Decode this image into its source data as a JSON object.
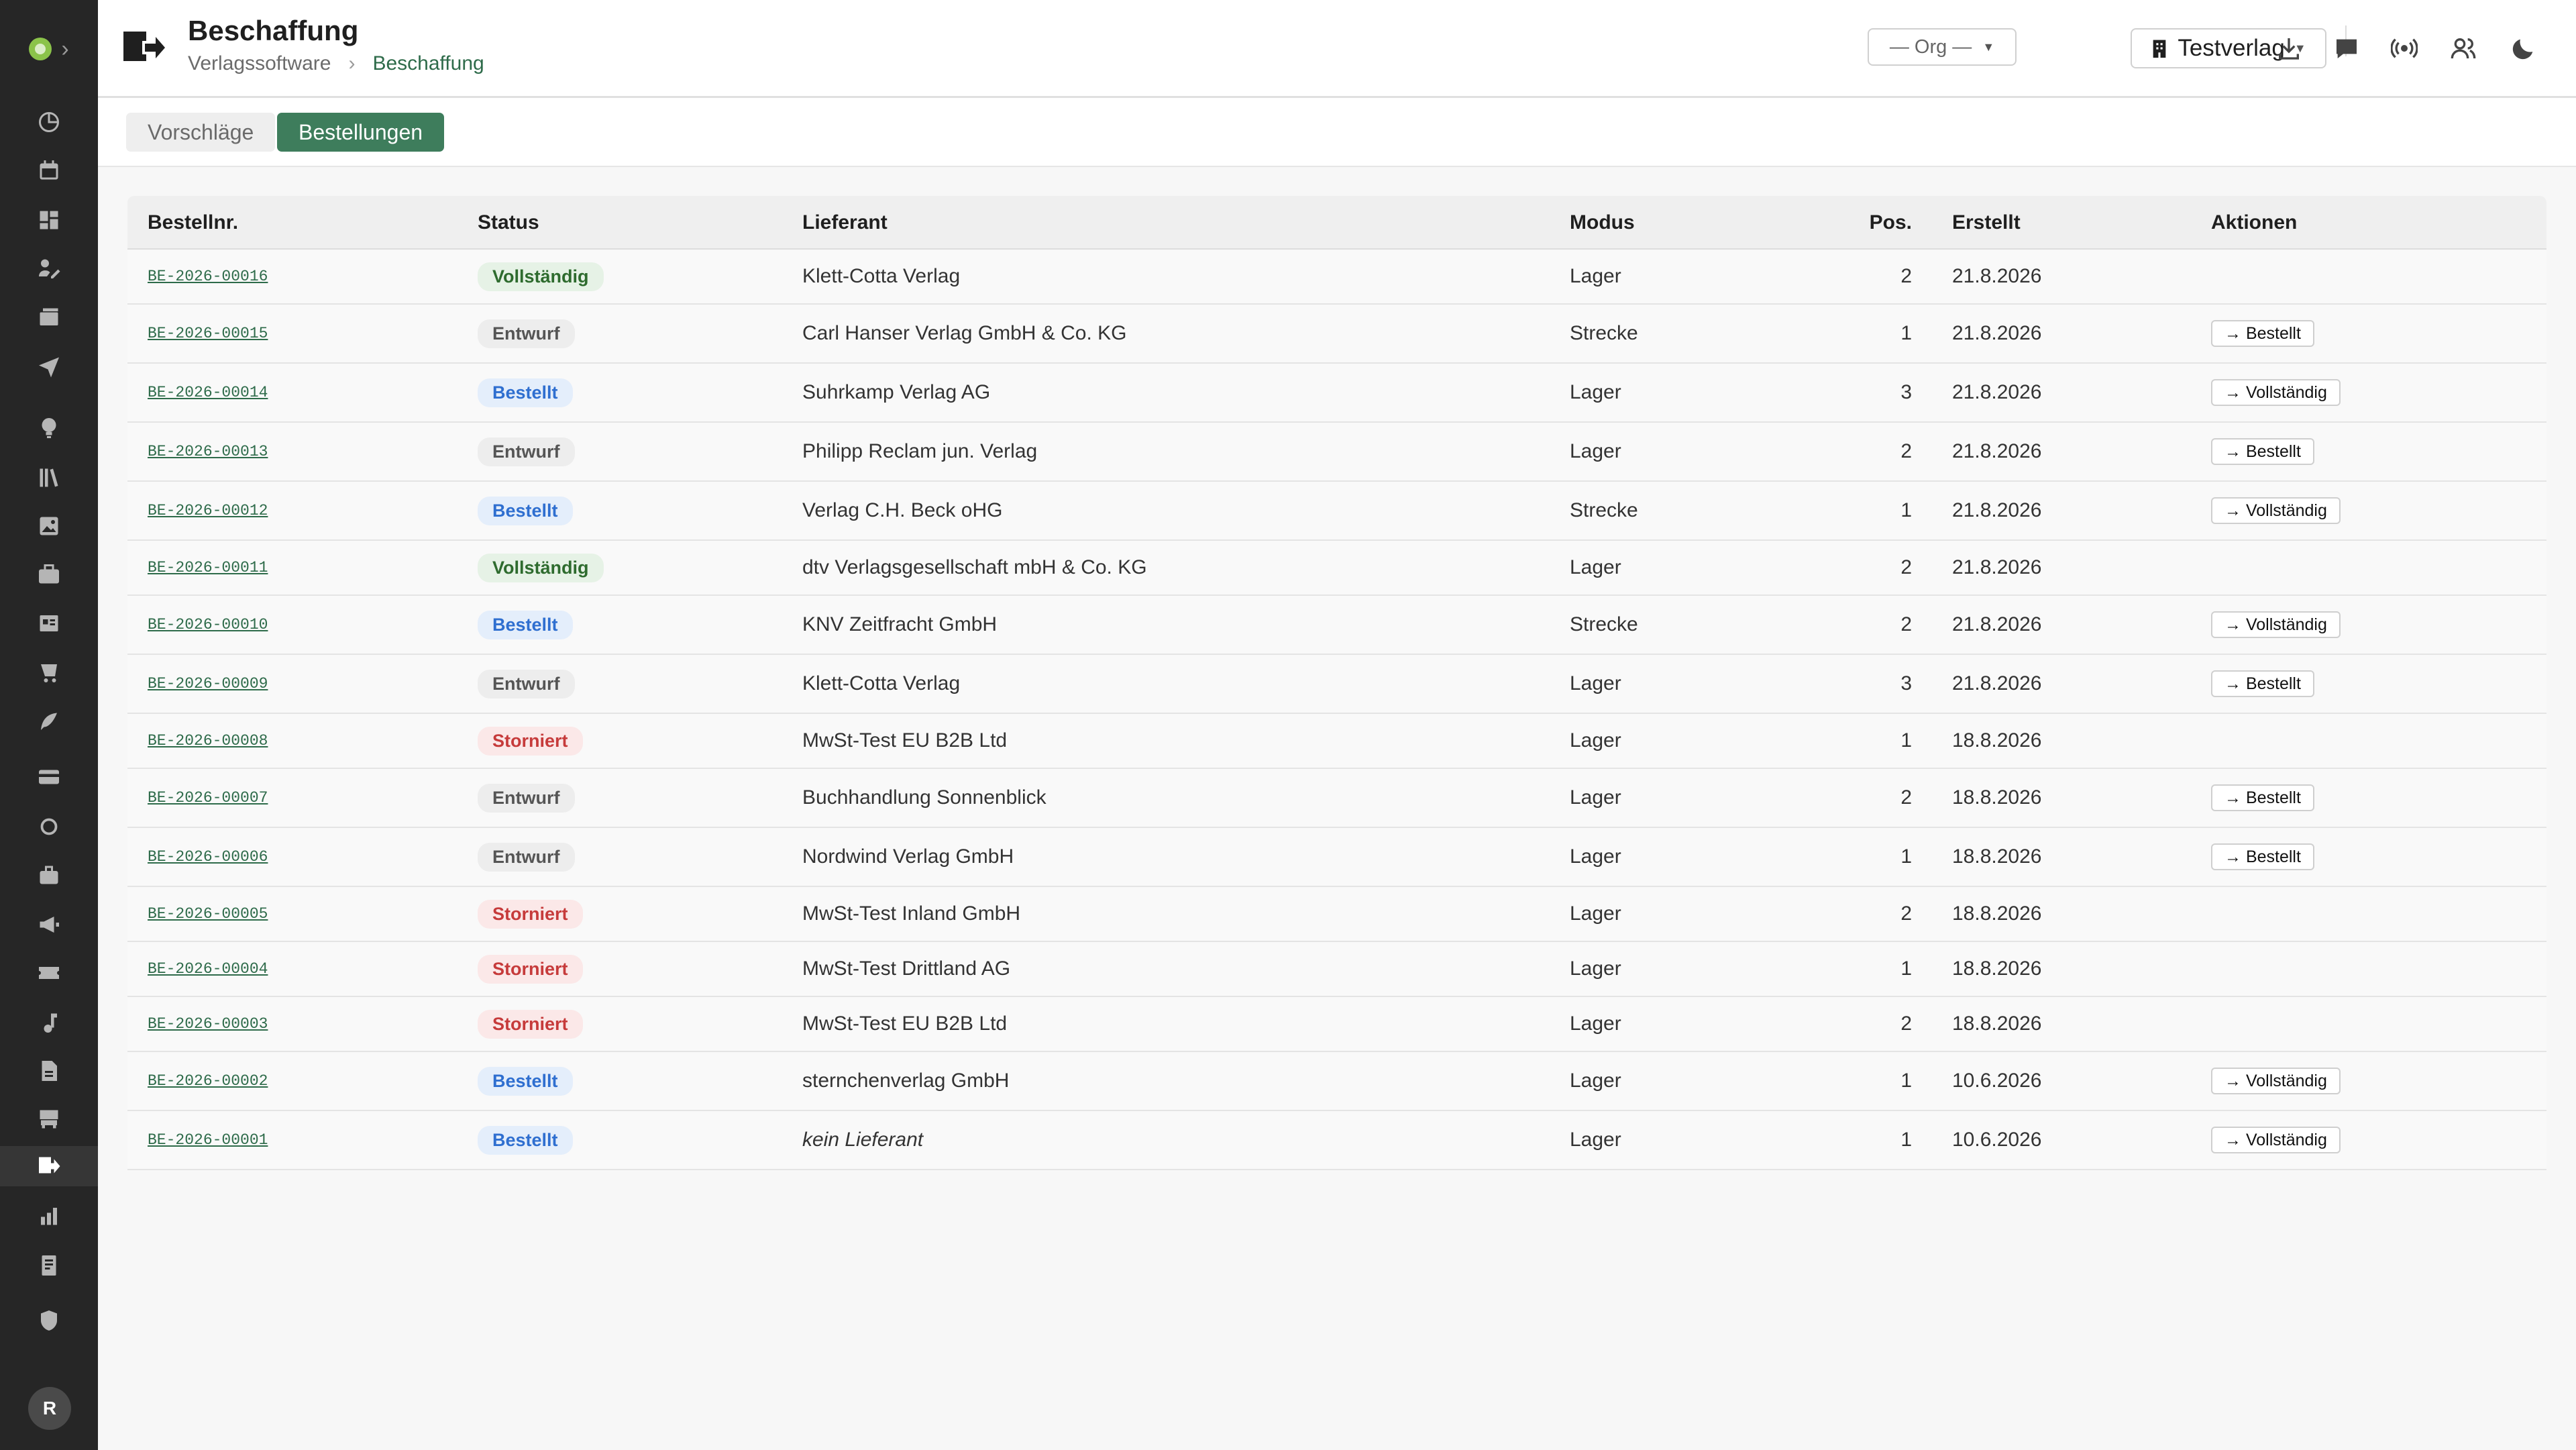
{
  "header": {
    "title": "Beschaffung",
    "breadcrumb": {
      "root": "Verlagssoftware",
      "separator": "›",
      "current": "Beschaffung"
    },
    "org_select": {
      "value": "— Org —"
    },
    "tenant_select": {
      "value": "Testverlag"
    }
  },
  "user": {
    "avatar_initial": "R"
  },
  "tabs": [
    {
      "label": "Vorschläge",
      "active": false
    },
    {
      "label": "Bestellungen",
      "active": true
    }
  ],
  "table": {
    "columns": {
      "id": "Bestellnr.",
      "status": "Status",
      "supplier": "Lieferant",
      "mode": "Modus",
      "pos": "Pos.",
      "created": "Erstellt",
      "actions": "Aktionen"
    },
    "rows": [
      {
        "id": "BE-2026-00016",
        "status": "Vollständig",
        "supplier": "Klett-Cotta Verlag",
        "mode": "Lager",
        "pos": "2",
        "created": "21.8.2026",
        "action": ""
      },
      {
        "id": "BE-2026-00015",
        "status": "Entwurf",
        "supplier": "Carl Hanser Verlag GmbH & Co. KG",
        "mode": "Strecke",
        "pos": "1",
        "created": "21.8.2026",
        "action": "→ Bestellt"
      },
      {
        "id": "BE-2026-00014",
        "status": "Bestellt",
        "supplier": "Suhrkamp Verlag AG",
        "mode": "Lager",
        "pos": "3",
        "created": "21.8.2026",
        "action": "→ Vollständig"
      },
      {
        "id": "BE-2026-00013",
        "status": "Entwurf",
        "supplier": "Philipp Reclam jun. Verlag",
        "mode": "Lager",
        "pos": "2",
        "created": "21.8.2026",
        "action": "→ Bestellt"
      },
      {
        "id": "BE-2026-00012",
        "status": "Bestellt",
        "supplier": "Verlag C.H. Beck oHG",
        "mode": "Strecke",
        "pos": "1",
        "created": "21.8.2026",
        "action": "→ Vollständig"
      },
      {
        "id": "BE-2026-00011",
        "status": "Vollständig",
        "supplier": "dtv Verlagsgesellschaft mbH & Co. KG",
        "mode": "Lager",
        "pos": "2",
        "created": "21.8.2026",
        "action": ""
      },
      {
        "id": "BE-2026-00010",
        "status": "Bestellt",
        "supplier": "KNV Zeitfracht GmbH",
        "mode": "Strecke",
        "pos": "2",
        "created": "21.8.2026",
        "action": "→ Vollständig"
      },
      {
        "id": "BE-2026-00009",
        "status": "Entwurf",
        "supplier": "Klett-Cotta Verlag",
        "mode": "Lager",
        "pos": "3",
        "created": "21.8.2026",
        "action": "→ Bestellt"
      },
      {
        "id": "BE-2026-00008",
        "status": "Storniert",
        "supplier": "MwSt-Test EU B2B Ltd",
        "mode": "Lager",
        "pos": "1",
        "created": "18.8.2026",
        "action": ""
      },
      {
        "id": "BE-2026-00007",
        "status": "Entwurf",
        "supplier": "Buchhandlung Sonnenblick",
        "mode": "Lager",
        "pos": "2",
        "created": "18.8.2026",
        "action": "→ Bestellt"
      },
      {
        "id": "BE-2026-00006",
        "status": "Entwurf",
        "supplier": "Nordwind Verlag GmbH",
        "mode": "Lager",
        "pos": "1",
        "created": "18.8.2026",
        "action": "→ Bestellt"
      },
      {
        "id": "BE-2026-00005",
        "status": "Storniert",
        "supplier": "MwSt-Test Inland GmbH",
        "mode": "Lager",
        "pos": "2",
        "created": "18.8.2026",
        "action": ""
      },
      {
        "id": "BE-2026-00004",
        "status": "Storniert",
        "supplier": "MwSt-Test Drittland AG",
        "mode": "Lager",
        "pos": "1",
        "created": "18.8.2026",
        "action": ""
      },
      {
        "id": "BE-2026-00003",
        "status": "Storniert",
        "supplier": "MwSt-Test EU B2B Ltd",
        "mode": "Lager",
        "pos": "2",
        "created": "18.8.2026",
        "action": ""
      },
      {
        "id": "BE-2026-00002",
        "status": "Bestellt",
        "supplier": "sternchenverlag GmbH",
        "mode": "Lager",
        "pos": "1",
        "created": "10.6.2026",
        "action": "→ Vollständig"
      },
      {
        "id": "BE-2026-00001",
        "status": "Bestellt",
        "supplier": "kein Lieferant",
        "supplier_missing": true,
        "mode": "Lager",
        "pos": "1",
        "created": "10.6.2026",
        "action": "→ Vollständig"
      }
    ]
  },
  "colors": {
    "sidebar_bg": "#262626",
    "accent": "#3e7d5c",
    "status_complete": "#2e6b2e",
    "status_ordered": "#2f6fd0",
    "status_cancelled": "#c63b3b",
    "status_draft": "#555555"
  },
  "icons": {
    "sidebar": [
      "pie-chart-icon",
      "calendar-icon",
      "dashboard-icon",
      "edit-icon",
      "inbox-icon",
      "send-icon",
      "lightbulb-icon",
      "library-icon",
      "image-icon",
      "briefcase-icon",
      "id-card-icon",
      "cart-icon",
      "feather-icon",
      "credit-card-icon",
      "circle-icon",
      "bag-icon",
      "megaphone-icon",
      "ticket-icon",
      "music-icon",
      "file-icon",
      "store-icon",
      "procurement-icon",
      "bar-chart-icon",
      "receipt-icon",
      "shield-icon"
    ],
    "header": [
      "download-icon",
      "chat-icon",
      "broadcast-icon",
      "users-icon",
      "moon-icon"
    ]
  }
}
